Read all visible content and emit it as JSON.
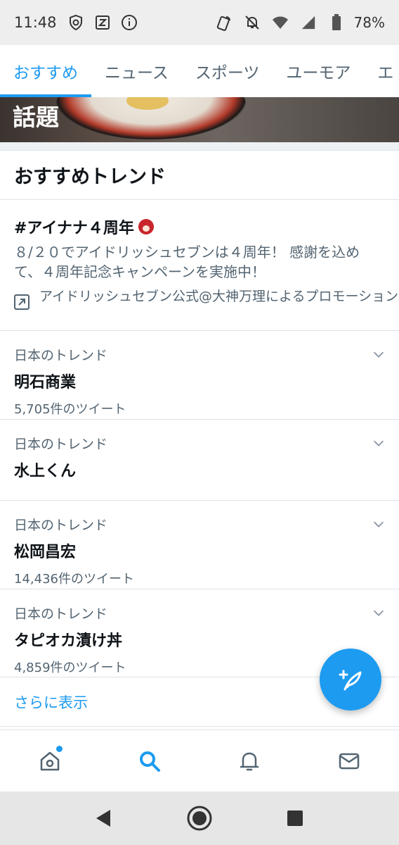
{
  "status_bar": {
    "time": "11:48",
    "battery": "78%",
    "left_icons": [
      "shield-icon",
      "z-app-icon",
      "info-icon"
    ],
    "right_icons": [
      "nfc-icon",
      "mute-bell-icon",
      "wifi-icon",
      "signal-icon",
      "battery-icon"
    ]
  },
  "tabs": [
    {
      "label": "おすすめ",
      "active": true
    },
    {
      "label": "ニュース",
      "active": false
    },
    {
      "label": "スポーツ",
      "active": false
    },
    {
      "label": "ユーモア",
      "active": false
    },
    {
      "label": "エ",
      "active": false
    }
  ],
  "banner": {
    "title": "話題"
  },
  "section": {
    "title": "おすすめトレンド"
  },
  "promo": {
    "title": "#アイナナ４周年",
    "description": "８/２０でアイドリッシュセブンは４周年！ 感謝を込めて、４周年記念キャンペーンを実施中！",
    "promoted_by": "アイドリッシュセブン公式@大神万理によるプロモーション"
  },
  "trends": [
    {
      "context": "日本のトレンド",
      "name": "明石商業",
      "count": "5,705件のツイート"
    },
    {
      "context": "日本のトレンド",
      "name": "水上くん",
      "count": ""
    },
    {
      "context": "日本のトレンド",
      "name": "松岡昌宏",
      "count": "14,436件のツイート"
    },
    {
      "context": "日本のトレンド",
      "name": "タピオカ漬け丼",
      "count": "4,859件のツイート"
    }
  ],
  "show_more": "さらに表示",
  "bottom_nav": [
    "home-icon",
    "search-icon",
    "notifications-icon",
    "messages-icon"
  ],
  "colors": {
    "accent": "#1d9bf0",
    "text": "#0f1419",
    "secondary": "#536471",
    "divider": "#dfe3e7"
  }
}
